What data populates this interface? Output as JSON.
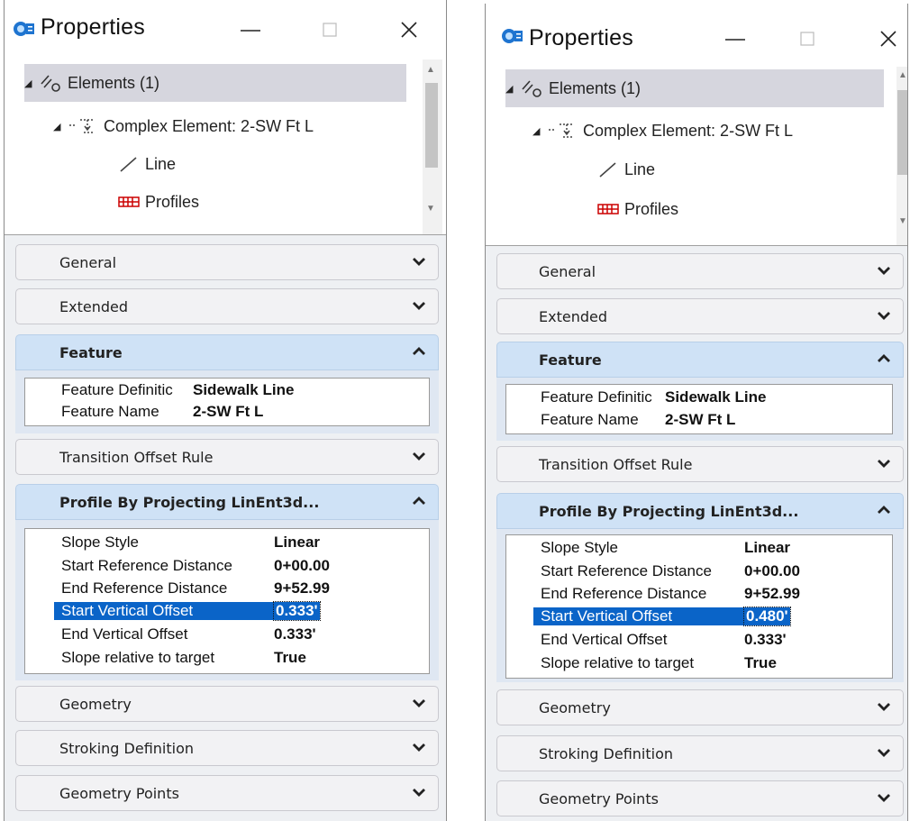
{
  "panels": [
    {
      "title": "Properties",
      "tree": [
        {
          "label": "Elements (1)"
        },
        {
          "label": "Complex Element: 2-SW Ft L"
        },
        {
          "label": "Line"
        },
        {
          "label": "Profiles"
        }
      ],
      "sections": {
        "general": "General",
        "extended": "Extended",
        "feature": "Feature",
        "transition": "Transition Offset Rule",
        "profile": "Profile By Projecting LinEnt3d...",
        "geometry": "Geometry",
        "stroking": "Stroking Definition",
        "geometry_points": "Geometry Points"
      },
      "feature_props": [
        {
          "key": "Feature Definitic",
          "value": "Sidewalk Line"
        },
        {
          "key": "Feature Name",
          "value": "2-SW Ft L"
        }
      ],
      "profile_props": [
        {
          "key": "Slope Style",
          "value": "Linear"
        },
        {
          "key": "Start Reference Distance",
          "value": "0+00.00"
        },
        {
          "key": "End Reference Distance",
          "value": "9+52.99"
        },
        {
          "key": "Start Vertical Offset",
          "value": "0.333'"
        },
        {
          "key": "End Vertical Offset",
          "value": "0.333'"
        },
        {
          "key": "Slope relative to target",
          "value": "True"
        }
      ]
    },
    {
      "title": "Properties",
      "tree": [
        {
          "label": "Elements (1)"
        },
        {
          "label": "Complex Element: 2-SW Ft L"
        },
        {
          "label": "Line"
        },
        {
          "label": "Profiles"
        }
      ],
      "sections": {
        "general": "General",
        "extended": "Extended",
        "feature": "Feature",
        "transition": "Transition Offset Rule",
        "profile": "Profile By Projecting LinEnt3d...",
        "geometry": "Geometry",
        "stroking": "Stroking Definition",
        "geometry_points": "Geometry Points"
      },
      "feature_props": [
        {
          "key": "Feature Definitic",
          "value": "Sidewalk Line"
        },
        {
          "key": "Feature Name",
          "value": "2-SW Ft L"
        }
      ],
      "profile_props": [
        {
          "key": "Slope Style",
          "value": "Linear"
        },
        {
          "key": "Start Reference Distance",
          "value": "0+00.00"
        },
        {
          "key": "End Reference Distance",
          "value": "9+52.99"
        },
        {
          "key": "Start Vertical Offset",
          "value": "0.480'"
        },
        {
          "key": "End Vertical Offset",
          "value": "0.333'"
        },
        {
          "key": "Slope relative to target",
          "value": "True"
        }
      ]
    }
  ],
  "highlight_color": "#0a64c8",
  "open_section_color": "#cfe2f6"
}
